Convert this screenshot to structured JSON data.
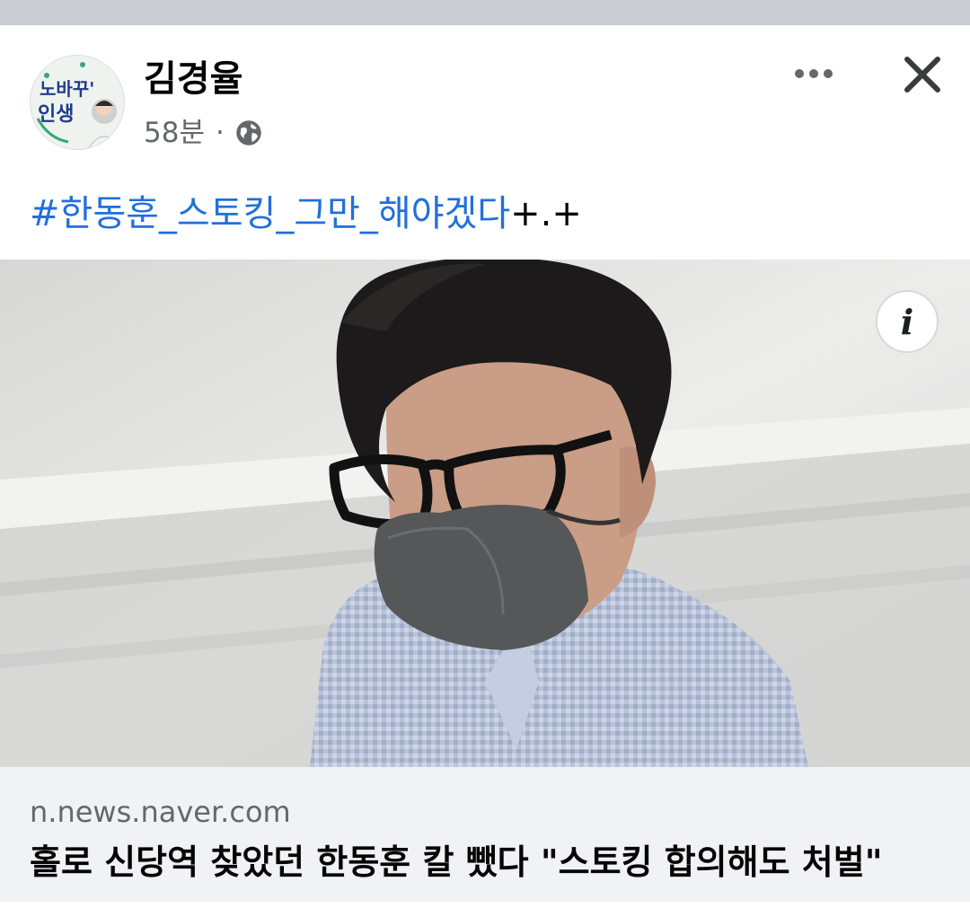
{
  "post": {
    "author": "김경율",
    "time": "58분",
    "separator": "·",
    "privacy_icon": "globe-icon",
    "hashtag": "#한동훈_스토킹_그만_해야겠다",
    "text_suffix": "+.+",
    "avatar_text_top": "노바꾸'",
    "avatar_text_bottom": "인생"
  },
  "actions": {
    "more_icon": "more-horizontal-icon",
    "close_icon": "close-icon",
    "info_icon": "info-icon",
    "info_glyph": "i"
  },
  "link": {
    "domain": "n.news.naver.com",
    "title": "홀로 신당역 찾았던 한동훈 칼 뺐다 \"스토킹 합의해도 처벌\""
  },
  "colors": {
    "hashtag": "#216fdb",
    "meta_text": "#65676b",
    "link_bg": "#f0f2f5"
  }
}
